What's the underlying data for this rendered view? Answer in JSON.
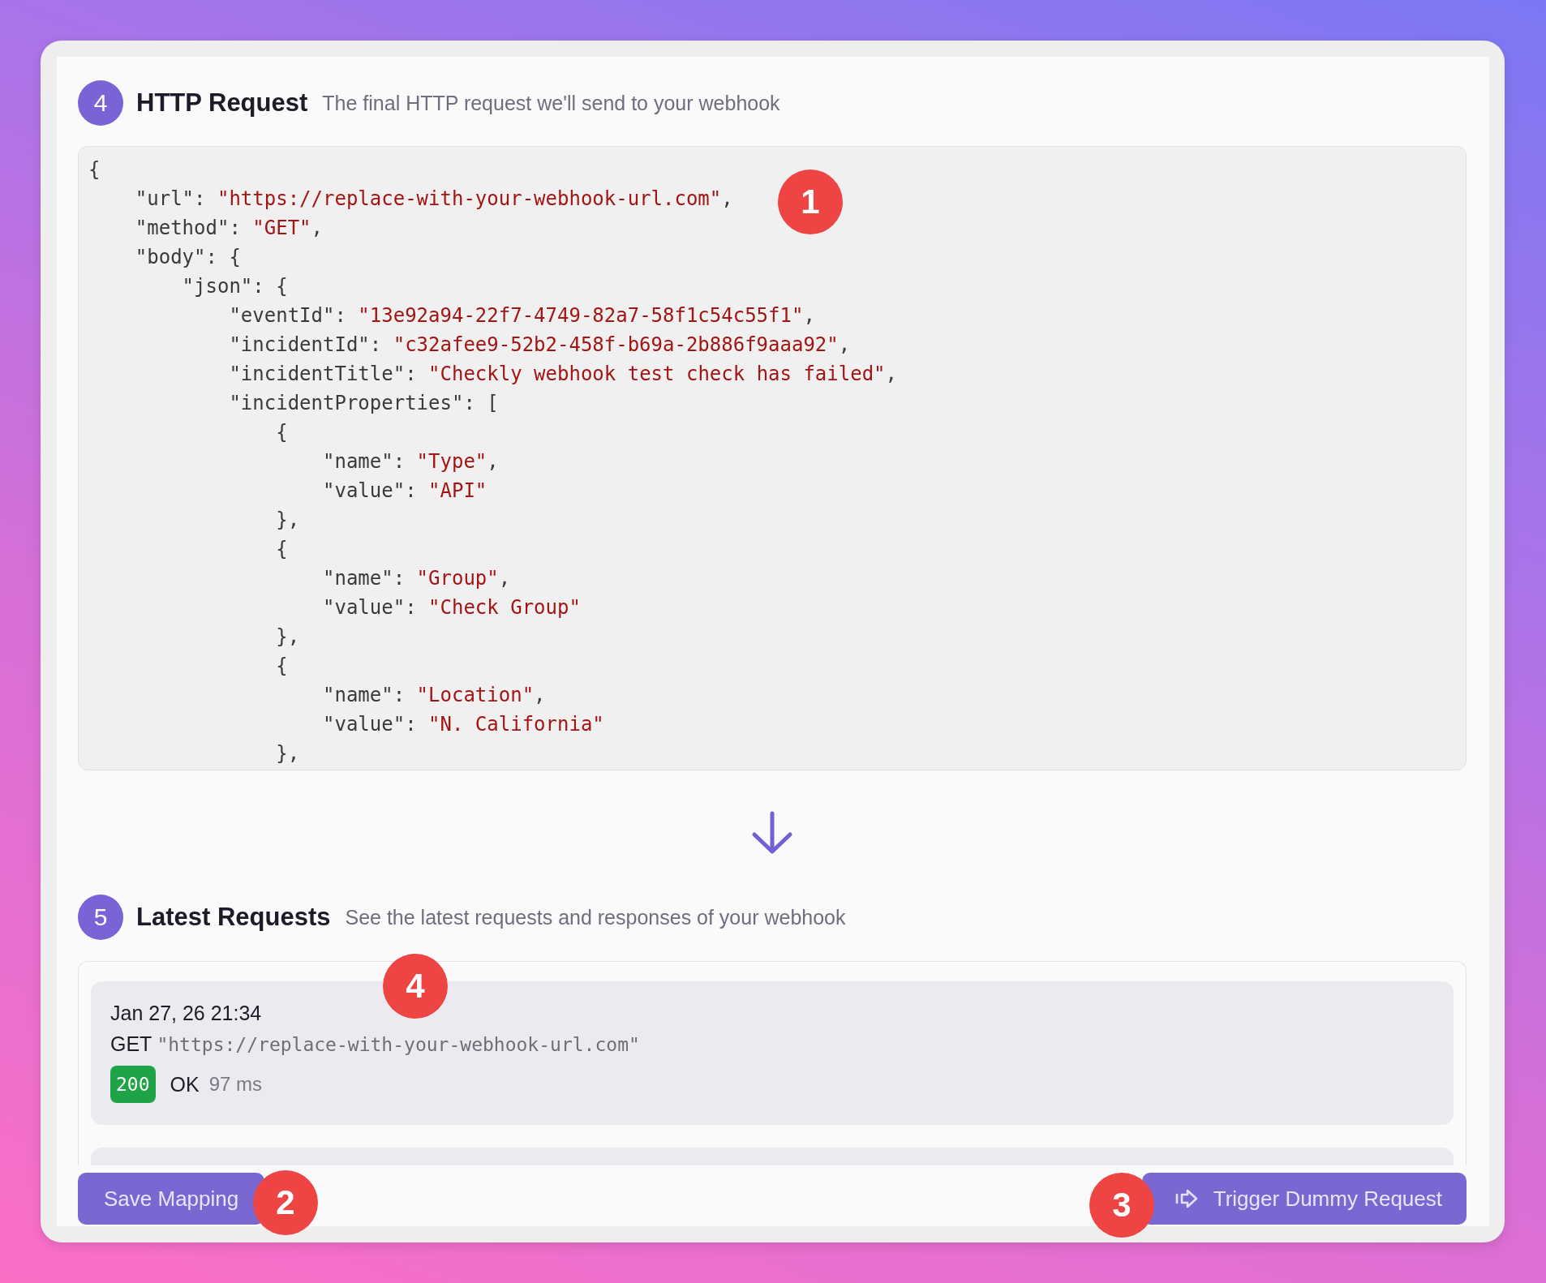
{
  "sections": [
    {
      "step": "4",
      "title": "HTTP Request",
      "subtitle": "The final HTTP request we'll send to your webhook"
    },
    {
      "step": "5",
      "title": "Latest Requests",
      "subtitle": "See the latest requests and responses of your webhook"
    }
  ],
  "code_lines": [
    "{",
    "    \"url\": \"https://replace-with-your-webhook-url.com\",",
    "    \"method\": \"GET\",",
    "    \"body\": {",
    "        \"json\": {",
    "            \"eventId\": \"13e92a94-22f7-4749-82a7-58f1c54c55f1\",",
    "            \"incidentId\": \"c32afee9-52b2-458f-b69a-2b886f9aaa92\",",
    "            \"incidentTitle\": \"Checkly webhook test check has failed\",",
    "            \"incidentProperties\": [",
    "                {",
    "                    \"name\": \"Type\",",
    "                    \"value\": \"API\"",
    "                },",
    "                {",
    "                    \"name\": \"Group\",",
    "                    \"value\": \"Check Group\"",
    "                },",
    "                {",
    "                    \"name\": \"Location\",",
    "                    \"value\": \"N. California\"",
    "                },"
  ],
  "requests": [
    {
      "kind": "full",
      "date": "Jan 27, 26 21:34",
      "method": "GET",
      "url": "\"https://replace-with-your-webhook-url.com\"",
      "status": "200",
      "status_text": "OK",
      "duration": "97 ms"
    },
    {
      "kind": "cut_off"
    }
  ],
  "buttons": [
    {
      "label": "Save Mapping",
      "kind": "plain"
    },
    {
      "label": "Trigger Dummy Request",
      "kind": "icon"
    }
  ],
  "annotations": [
    {
      "label": "1"
    },
    {
      "label": "2"
    },
    {
      "label": "3"
    },
    {
      "label": "4"
    }
  ]
}
